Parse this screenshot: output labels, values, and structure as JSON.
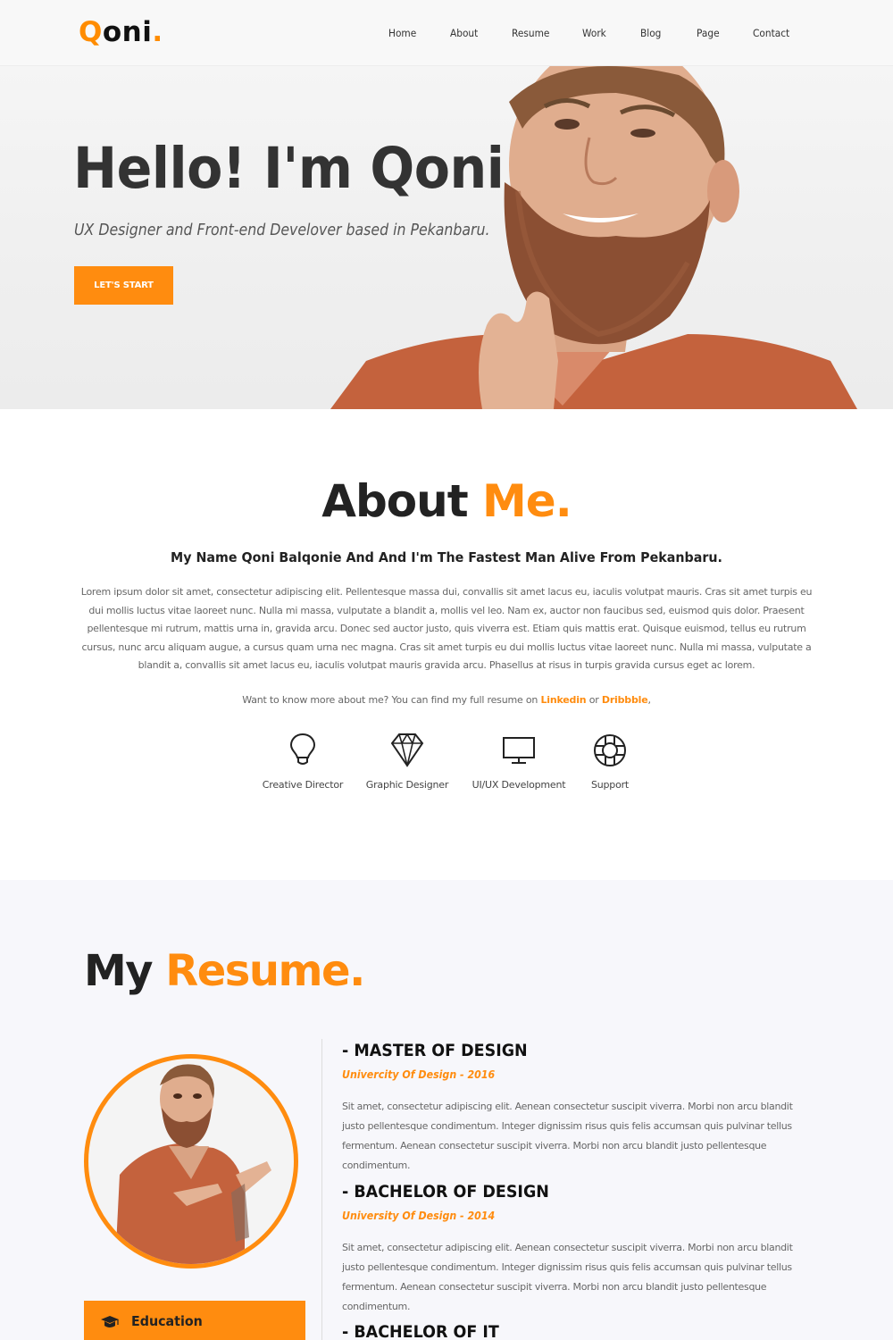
{
  "header": {
    "logo": {
      "first": "Q",
      "rest": "oni",
      "dot": "."
    },
    "nav": [
      {
        "label": "Home"
      },
      {
        "label": "About"
      },
      {
        "label": "Resume"
      },
      {
        "label": "Work"
      },
      {
        "label": "Blog"
      },
      {
        "label": "Page"
      },
      {
        "label": "Contact"
      }
    ]
  },
  "hero": {
    "title": "Hello! I'm Qoni",
    "subtitle": "UX Designer and Front-end Develover based in Pekanbaru.",
    "button_label": "LET'S START"
  },
  "about": {
    "title_main": "About ",
    "title_accent": "Me.",
    "subtitle": "My Name Qoni Balqonie And And I'm The Fastest Man Alive From Pekanbaru.",
    "body": "Lorem ipsum dolor sit amet, consectetur adipiscing elit. Pellentesque massa dui, convallis sit amet lacus eu, iaculis volutpat mauris. Cras sit amet turpis eu dui mollis luctus vitae laoreet nunc. Nulla mi massa, vulputate a blandit a, mollis vel leo. Nam ex, auctor non faucibus sed, euismod quis dolor. Praesent pellentesque mi rutrum, mattis urna in, gravida arcu. Donec sed auctor justo, quis viverra est. Etiam quis mattis erat. Quisque euismod, tellus eu rutrum cursus, nunc arcu aliquam augue, a cursus quam urna nec magna. Cras sit amet turpis eu dui mollis luctus vitae laoreet nunc. Nulla mi massa, vulputate a blandit a, convallis sit amet lacus eu, iaculis volutpat mauris gravida arcu. Phasellus at risus in turpis gravida cursus eget ac lorem.",
    "more_prefix": "Want to know more about me? You can find my full resume on ",
    "link_linkedin": "Linkedin",
    "more_or": " or ",
    "link_dribbble": "Dribbble",
    "more_suffix": ",",
    "skills": [
      {
        "label": "Creative Director",
        "icon": "lightbulb-icon"
      },
      {
        "label": "Graphic Designer",
        "icon": "diamond-icon"
      },
      {
        "label": "UI/UX Development",
        "icon": "monitor-icon"
      },
      {
        "label": "Support",
        "icon": "lifebuoy-icon"
      }
    ]
  },
  "resume": {
    "title_main": "My ",
    "title_accent": "Resume.",
    "tab_label": "Education",
    "entries": [
      {
        "title": "- MASTER OF DESIGN",
        "school": "Univercity Of Design - 2016",
        "desc": "Sit amet, consectetur adipiscing elit. Aenean consectetur suscipit viverra. Morbi non arcu blandit justo pellentesque condimentum. Integer dignissim risus quis felis accumsan quis pulvinar tellus fermentum. Aenean consectetur suscipit viverra. Morbi non arcu blandit justo pellentesque condimentum."
      },
      {
        "title": "- BACHELOR OF DESIGN",
        "school": "University Of Design - 2014",
        "desc": "Sit amet, consectetur adipiscing elit. Aenean consectetur suscipit viverra. Morbi non arcu blandit justo pellentesque condimentum. Integer dignissim risus quis felis accumsan quis pulvinar tellus fermentum. Aenean consectetur suscipit viverra. Morbi non arcu blandit justo pellentesque condimentum."
      },
      {
        "title": "- BACHELOR OF IT"
      }
    ]
  },
  "colors": {
    "accent": "#ff8c0f",
    "heading": "#222222",
    "body_text": "#666666",
    "resume_bg": "#f7f7fb"
  }
}
